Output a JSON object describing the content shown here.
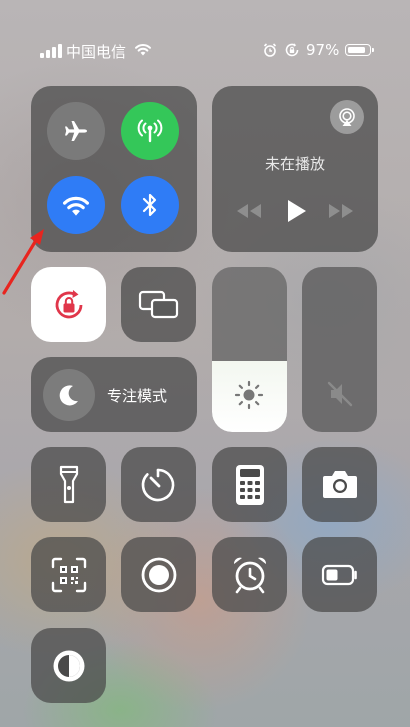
{
  "status_bar": {
    "carrier": "中国电信",
    "battery_percent": "97%",
    "icons": [
      "signal-bars-icon",
      "wifi-icon",
      "alarm-icon",
      "orientation-lock-icon",
      "battery-icon"
    ]
  },
  "connectivity": {
    "airplane": {
      "icon": "airplane-icon",
      "active": false
    },
    "cellular": {
      "icon": "cellular-antenna-icon",
      "active": true,
      "color": "#34c759"
    },
    "wifi": {
      "icon": "wifi-icon",
      "active": true,
      "color": "#2f7cf6"
    },
    "bluetooth": {
      "icon": "bluetooth-icon",
      "active": true,
      "color": "#2f7cf6"
    }
  },
  "media": {
    "status": "未在播放",
    "controls": [
      "rewind-icon",
      "play-icon",
      "fast-forward-icon"
    ],
    "airplay_icon": "airplay-audio-icon"
  },
  "orientation_lock": {
    "icon": "orientation-lock-icon",
    "active": true,
    "color": "#e0364a"
  },
  "screen_mirroring": {
    "icon": "screen-mirroring-icon"
  },
  "focus": {
    "label": "专注模式",
    "icon": "moon-icon"
  },
  "brightness": {
    "level": 0.43,
    "icon": "sun-icon"
  },
  "volume": {
    "level": 0.0,
    "icon": "speaker-muted-icon"
  },
  "shortcuts": [
    {
      "name": "flashlight",
      "icon": "flashlight-icon"
    },
    {
      "name": "timer",
      "icon": "timer-icon"
    },
    {
      "name": "calculator",
      "icon": "calculator-icon"
    },
    {
      "name": "camera",
      "icon": "camera-icon"
    },
    {
      "name": "qr-scanner",
      "icon": "qr-code-scanner-icon"
    },
    {
      "name": "screen-recording",
      "icon": "screen-record-icon"
    },
    {
      "name": "alarm",
      "icon": "alarm-clock-icon"
    },
    {
      "name": "low-power-mode",
      "icon": "low-power-battery-icon"
    },
    {
      "name": "dark-mode",
      "icon": "dark-mode-icon"
    }
  ],
  "colors": {
    "tile": "#484848",
    "accent_blue": "#2f7cf6",
    "accent_green": "#34c759",
    "annotation_red": "#e8251f"
  }
}
